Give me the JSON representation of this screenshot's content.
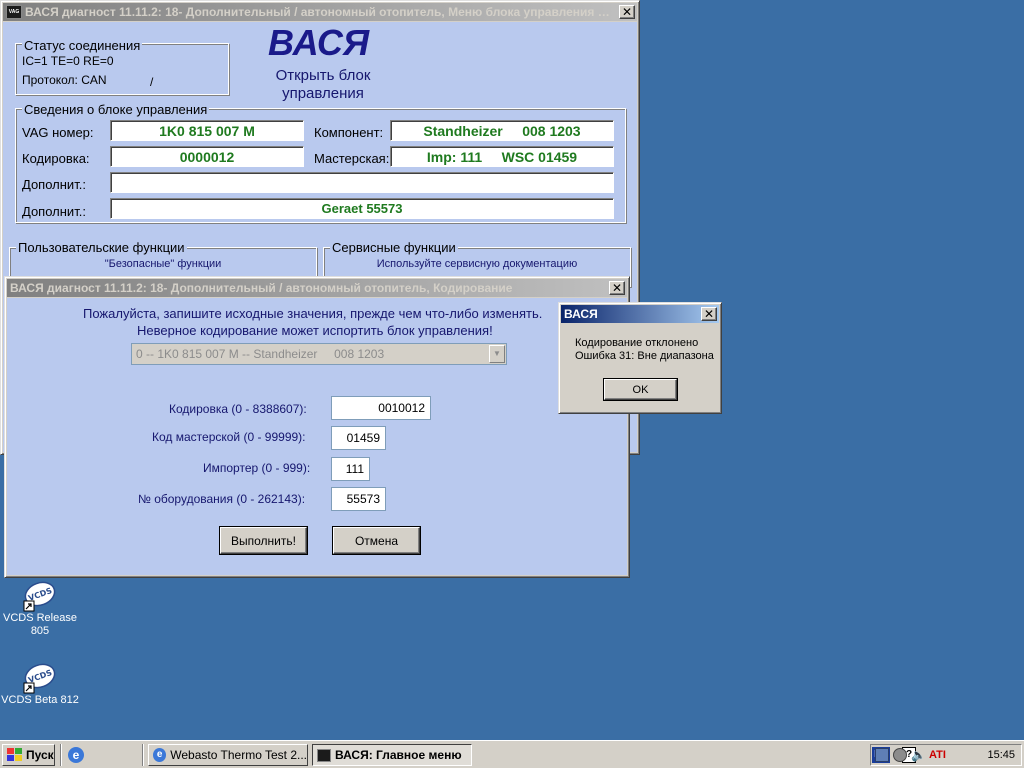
{
  "main_window": {
    "title": "ВАСЯ диагност 11.11.2: 18- Дополнительный / автономный отопитель,  Меню блока управления (1...",
    "close": "✕",
    "app_icon": "vasya-app-icon",
    "logo": "ВАСЯ",
    "open_block_line1": "Открыть блок",
    "open_block_line2": "управления",
    "conn_status": {
      "title": "Статус соединения",
      "line1": "IC=1  TE=0   RE=0",
      "line2": "Протокол: CAN",
      "slash": "/"
    },
    "control_info": {
      "title": "Сведения о блоке управления",
      "vag_label": "VAG номер:",
      "vag_value": "1K0 815 007 M",
      "component_label": "Компонент:",
      "component_value": "Standheizer     008 1203",
      "coding_label": "Кодировка:",
      "coding_value": "0000012",
      "workshop_label": "Мастерская:",
      "workshop_value": "Imp: 111     WSC 01459",
      "extra1_label": "Дополнит.:",
      "extra1_value": "",
      "extra2_label": "Дополнит.:",
      "extra2_value": "Geraet 55573"
    },
    "user_functions": {
      "title": "Пользовательские функции",
      "subtitle": "\"Безопасные\" функции"
    },
    "service_functions": {
      "title": "Сервисные функции",
      "subtitle": "Используйте сервисную документацию"
    }
  },
  "coding_window": {
    "title": "ВАСЯ диагност 11.11.2: 18- Дополнительный / автономный отопитель,  Кодирование",
    "close": "✕",
    "warning_line1": "Пожалуйста, запишите исходные значения, прежде чем что-либо изменять.",
    "warning_line2": "Неверное кодирование может испортить блок управления!",
    "module_select": "0 -- 1K0 815 007 M -- Standheizer     008 1203",
    "fields": [
      {
        "label": "Кодировка (0 - 8388607):",
        "value": "0010012"
      },
      {
        "label": "Код мастерской (0 - 99999):",
        "value": "01459"
      },
      {
        "label": "Импортер (0 - 999):",
        "value": "111"
      },
      {
        "label": "№ оборудования (0 - 262143):",
        "value": "55573"
      }
    ],
    "execute_button": "Выполнить!",
    "cancel_button": "Отмена"
  },
  "error_dialog": {
    "title": "ВАСЯ",
    "close": "✕",
    "message_line1": "Кодирование отклонено",
    "message_line2": "Ошибка 31: Вне диапазона",
    "ok_button": "OK"
  },
  "desktop": {
    "icons": [
      {
        "line1": "VCDS Release",
        "line2": "805",
        "badge": "VCDS"
      },
      {
        "line1": "VCDS Beta 812",
        "line2": "",
        "badge": "VCDS"
      }
    ]
  },
  "taskbar": {
    "start_label": "Пуск",
    "quicklaunch_icon": "ie-icon",
    "tasks": [
      {
        "label": "Webasto Thermo Test 2...",
        "icon": "ie-icon"
      },
      {
        "label": "ВАСЯ:  Главное меню",
        "icon": "vasya-app-icon"
      }
    ],
    "lang": "EN",
    "help_icon": "?",
    "clock": "15:45"
  }
}
